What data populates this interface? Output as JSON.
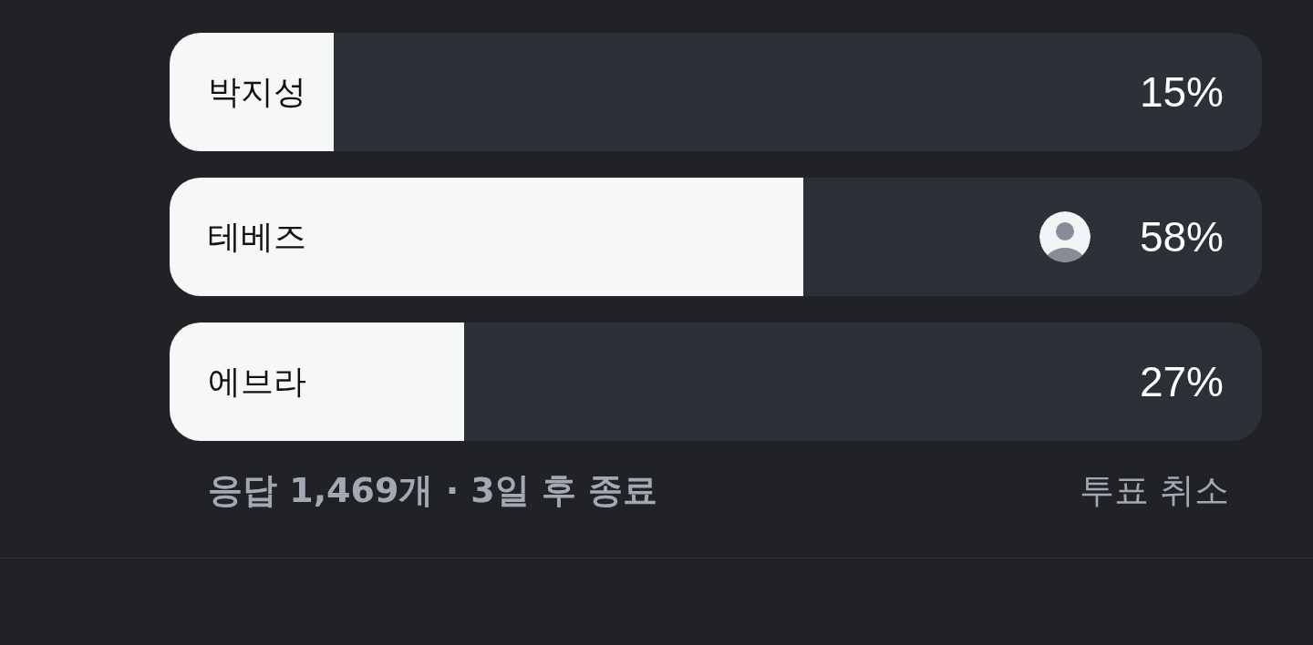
{
  "options": [
    {
      "label": "박지성",
      "level": 0.15,
      "percent": "15%",
      "selected": false
    },
    {
      "label": "테베즈",
      "level": 0.58,
      "percent": "58%",
      "selected": true
    },
    {
      "label": "에브라",
      "level": 0.27,
      "percent": "27%",
      "selected": false
    }
  ],
  "footer": {
    "summary": "응답 1,469개 · 3일 후 종료",
    "action": "투표 취소"
  }
}
